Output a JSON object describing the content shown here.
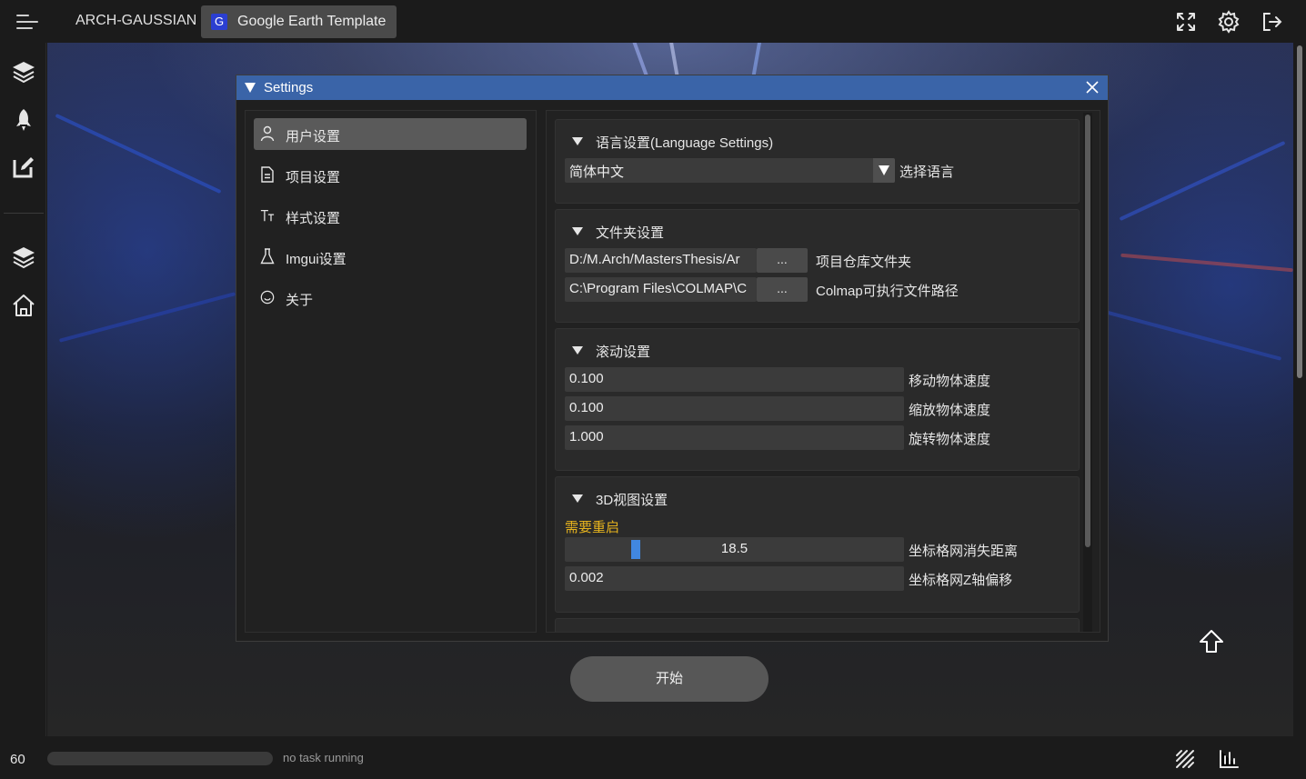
{
  "topbar": {
    "app_title": "ARCH-GAUSSIAN",
    "tab": {
      "letter": "G",
      "label": "Google Earth Template"
    },
    "icons": [
      "fullscreen-icon",
      "gear-icon",
      "logout-icon"
    ]
  },
  "sidebar": {
    "icons": [
      "layers-icon",
      "rocket-icon",
      "edit-icon",
      "layers-icon",
      "home-icon"
    ]
  },
  "settings": {
    "title": "Settings",
    "nav": [
      {
        "label": "用户设置",
        "icon": "user-icon",
        "active": true
      },
      {
        "label": "项目设置",
        "icon": "document-icon",
        "active": false
      },
      {
        "label": "样式设置",
        "icon": "text-style-icon",
        "active": false
      },
      {
        "label": "Imgui设置",
        "icon": "flask-icon",
        "active": false
      },
      {
        "label": "关于",
        "icon": "smiley-icon",
        "active": false
      }
    ],
    "sections": {
      "language": {
        "title": "语言设置(Language Settings)",
        "selected": "简体中文",
        "label": "选择语言"
      },
      "folders": {
        "title": "文件夹设置",
        "repo_path": "D:/M.Arch/MastersThesis/Ar",
        "repo_button": "...",
        "repo_label": "项目仓库文件夹",
        "colmap_path": "C:\\Program Files\\COLMAP\\C",
        "colmap_button": "...",
        "colmap_label": "Colmap可执行文件路径"
      },
      "scroll": {
        "title": "滚动设置",
        "move_speed": "0.100",
        "move_label": "移动物体速度",
        "zoom_speed": "0.100",
        "zoom_label": "缩放物体速度",
        "rotate_speed": "1.000",
        "rotate_label": "旋转物体速度"
      },
      "view3d": {
        "title": "3D视图设置",
        "warning": "需要重启",
        "grid_fade_distance": "18.5",
        "grid_fade_fraction": 0.2,
        "grid_fade_label": "坐标格网消失距离",
        "grid_z_offset": "0.002",
        "grid_z_label": "坐标格网Z轴偏移"
      }
    }
  },
  "start_button": "开始",
  "statusbar": {
    "fps": "60",
    "task": "no task running",
    "progress": 0
  },
  "colors": {
    "accent": "#3a64a8",
    "slider": "#4187e0",
    "warning": "#e6b31e"
  }
}
